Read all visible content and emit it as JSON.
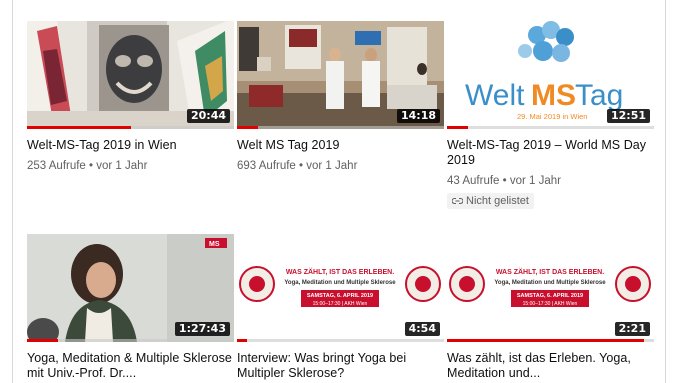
{
  "videos": [
    {
      "title": "Welt-MS-Tag 2019 in Wien",
      "duration": "20:44",
      "views": "253 Aufrufe",
      "age": "vor 1 Jahr",
      "progress": 0.5,
      "thumbnail": "art-painting"
    },
    {
      "title": "Welt MS Tag 2019",
      "duration": "14:18",
      "views": "693 Aufrufe",
      "age": "vor 1 Jahr",
      "progress": 0.1,
      "thumbnail": "conference-room"
    },
    {
      "title": "Welt-MS-Tag 2019 – World MS Day 2019",
      "duration": "12:51",
      "views": "43 Aufrufe",
      "age": "vor 1 Jahr",
      "progress": 0.1,
      "badge": "Nicht gelistet",
      "badge_icon": "link-icon",
      "thumbnail": "weltmstag-logo",
      "logo_text_a": "Welt",
      "logo_text_b": "MS",
      "logo_text_c": "Tag",
      "logo_date": "29. Mai 2019 in Wien"
    },
    {
      "title": "Yoga, Meditation & Multiple Sklerose mit Univ.-Prof. Dr....",
      "duration": "1:27:43",
      "progress": 0.15,
      "thumbnail": "speaker-photo",
      "corner_label": "MS"
    },
    {
      "title": "Interview: Was bringt Yoga bei Multipler Sklerose?",
      "duration": "4:54",
      "progress": 0.05,
      "thumbnail": "symposium-banner",
      "banner_headline": "WAS ZÄHLT, IST DAS ERLEBEN.",
      "banner_sub": "Yoga, Meditation und Multiple Sklerose",
      "banner_date": "SAMSTAG, 6. APRIL 2019",
      "banner_time": "15:00–17:30 | AKH Wien"
    },
    {
      "title": "Was zählt, ist das Erleben. Yoga, Meditation und...",
      "duration": "2:21",
      "progress": 0.95,
      "thumbnail": "symposium-banner",
      "banner_headline": "WAS ZÄHLT, IST DAS ERLEBEN.",
      "banner_sub": "Yoga, Meditation und Multiple Sklerose",
      "banner_date": "SAMSTAG, 6. APRIL 2019",
      "banner_time": "15:00–17:30 | AKH Wien"
    }
  ],
  "colors": {
    "progress": "#e00000",
    "logo_blue": "#3a8fc9",
    "logo_orange": "#f08a24",
    "banner_red": "#c8102e"
  }
}
